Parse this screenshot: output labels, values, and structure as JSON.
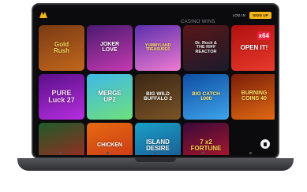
{
  "header": {
    "section_title": "CASINO WINS",
    "login_label": "LOG IN",
    "signup_label": "SIGN UP",
    "accent_color": "#f4b616"
  },
  "games": [
    {
      "title": "Gold\nRush",
      "bg": "linear-gradient(160deg,#7a3b14,#c1661d)",
      "fg": "#ffd75a",
      "size": 8
    },
    {
      "title": "JOKER\nLOVE",
      "bg": "linear-gradient(160deg,#4a1a70,#c63ab1)",
      "fg": "#ffffff",
      "size": 7
    },
    {
      "title": "YUMMYLAND\nTREASURES",
      "bg": "linear-gradient(160deg,#5b2fae,#f07ad0)",
      "fg": "#ffe36a",
      "size": 5
    },
    {
      "title": "Dr. Rock &\nTHE RIFF\nREACTOR",
      "bg": "linear-gradient(160deg,#5a1616,#1b1b2e)",
      "fg": "#f2f2f2",
      "size": 5.5
    },
    {
      "title": "OPEN IT!",
      "bg": "linear-gradient(160deg,#b01010,#e83b2c)",
      "fg": "#ffffff",
      "size": 8,
      "badge": "x64"
    },
    {
      "title": "PURE\nLuck 27",
      "bg": "linear-gradient(160deg,#5a1088,#b62ee0)",
      "fg": "#ffd3f7",
      "size": 9
    },
    {
      "title": "MERGE\nUP2",
      "bg": "linear-gradient(160deg,#3fb8e8,#6fe07b)",
      "fg": "#ffffff",
      "size": 8
    },
    {
      "title": "BIG WILD\nBUFFALO 2",
      "bg": "linear-gradient(160deg,#3a2614,#7a5427)",
      "fg": "#ffffff",
      "size": 6.5
    },
    {
      "title": "BIG CATCH\n1000",
      "bg": "linear-gradient(160deg,#0e4ea3,#3fa3ea)",
      "fg": "#ffe87a",
      "size": 6.5
    },
    {
      "title": "BURNING\nCOINS 40",
      "bg": "linear-gradient(160deg,#7a1e08,#e26a14)",
      "fg": "#ffe36a",
      "size": 7
    },
    {
      "title": "",
      "bg": "linear-gradient(160deg,#1e5c2a,#b0221f)",
      "fg": "#ffffff",
      "size": 7
    },
    {
      "title": "CHICKEN",
      "bg": "linear-gradient(160deg,#e56b10,#c8301a)",
      "fg": "#ffffff",
      "size": 7
    },
    {
      "title": "ISLAND\nDESIRE",
      "bg": "linear-gradient(160deg,#18a0c8,#1d4f88)",
      "fg": "#ffffff",
      "size": 8
    },
    {
      "title": "7 x2\nFORTUNE",
      "bg": "linear-gradient(160deg,#3a0a3a,#c01a2a)",
      "fg": "#ffd24a",
      "size": 8
    },
    {
      "title": "",
      "bg": "linear-gradient(160deg,#0b0b0d,#0b0b0d)",
      "fg": "#ffffff",
      "size": 7
    }
  ],
  "icons": [
    "logo-icon",
    "chat-icon"
  ]
}
